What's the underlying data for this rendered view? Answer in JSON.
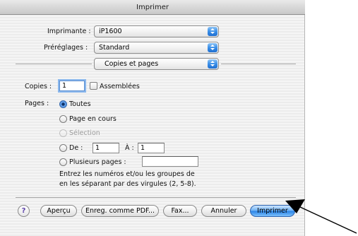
{
  "window": {
    "title": "Imprimer"
  },
  "printer": {
    "label": "Imprimante :",
    "value": "iP1600"
  },
  "presets": {
    "label": "Préréglages :",
    "value": "Standard"
  },
  "panel": {
    "value": "Copies et pages"
  },
  "copies": {
    "label": "Copies :",
    "value": "1",
    "collated_label": "Assemblées",
    "collated_checked": false
  },
  "pages": {
    "label": "Pages :",
    "options": {
      "all": "Toutes",
      "current": "Page en cours",
      "selection": "Sélection",
      "from": "De :",
      "to": "À :",
      "multiple": "Plusieurs pages :"
    },
    "selected": "all",
    "from_value": "1",
    "to_value": "1",
    "multiple_value": "",
    "help_line1": "Entrez les numéros et/ou les groupes de",
    "help_line2": "en les séparant par des virgules (2, 5-8)."
  },
  "buttons": {
    "help": "?",
    "preview": "Aperçu",
    "save_pdf": "Enreg. comme PDF...",
    "fax": "Fax...",
    "cancel": "Annuler",
    "print": "Imprimer"
  },
  "colors": {
    "accent": "#3a8fe8",
    "default_button": "#2d86e8"
  },
  "icons": {
    "pointer": "arrow-annotation-icon"
  }
}
